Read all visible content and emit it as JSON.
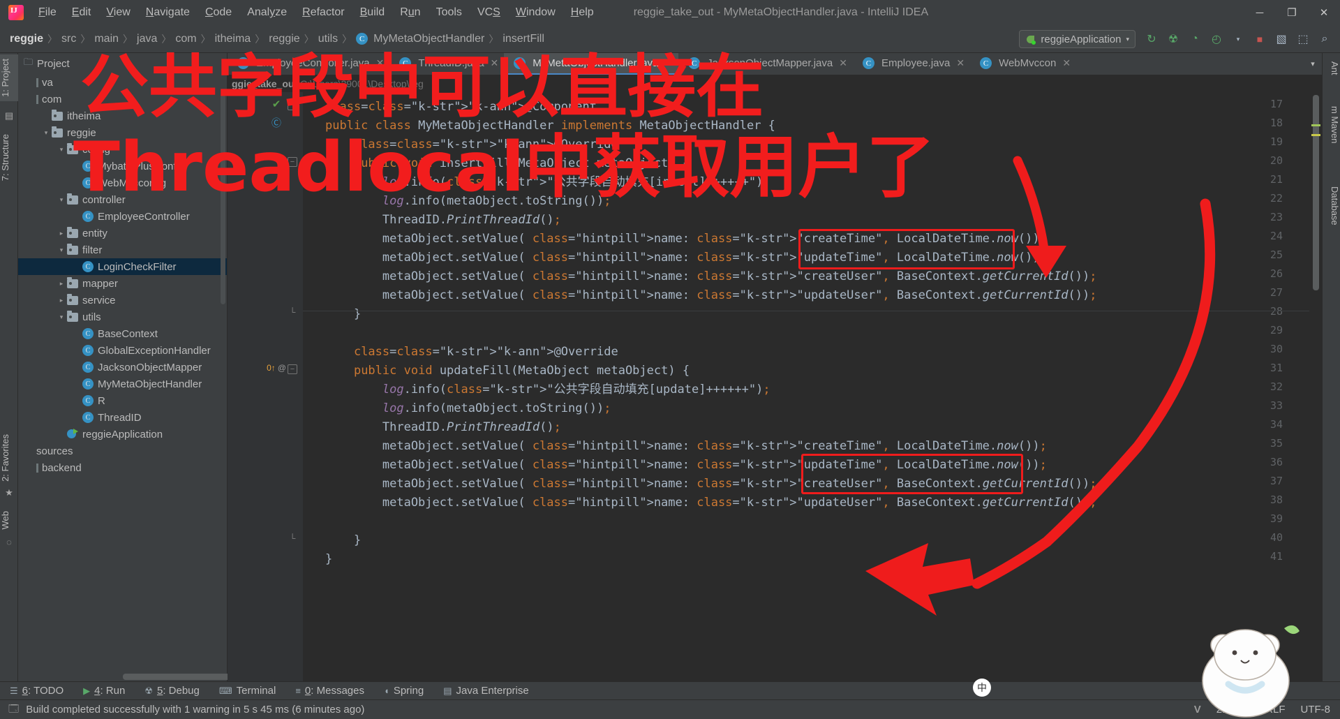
{
  "window": {
    "title": "reggie_take_out - MyMetaObjectHandler.java - IntelliJ IDEA",
    "logo_label": "IJ",
    "minimize": "─",
    "maximize": "❐",
    "close": "✕"
  },
  "menu": [
    {
      "label": "File",
      "mnemonic": "F"
    },
    {
      "label": "Edit",
      "mnemonic": "E"
    },
    {
      "label": "View",
      "mnemonic": "V"
    },
    {
      "label": "Navigate",
      "mnemonic": "N"
    },
    {
      "label": "Code",
      "mnemonic": "C"
    },
    {
      "label": "Analyze",
      "mnemonic": "y"
    },
    {
      "label": "Refactor",
      "mnemonic": "R"
    },
    {
      "label": "Build",
      "mnemonic": "B"
    },
    {
      "label": "Run",
      "mnemonic": "u"
    },
    {
      "label": "Tools",
      "mnemonic": ""
    },
    {
      "label": "VCS",
      "mnemonic": "S"
    },
    {
      "label": "Window",
      "mnemonic": "W"
    },
    {
      "label": "Help",
      "mnemonic": "H"
    }
  ],
  "breadcrumb": {
    "segments": [
      "reggie",
      "src",
      "main",
      "java",
      "com",
      "itheima",
      "reggie",
      "utils"
    ],
    "class_badge": "C",
    "class_name": "MyMetaObjectHandler",
    "member": "insertFill",
    "separator": "〉"
  },
  "toolbar": {
    "run_config": "reggieApplication",
    "run_config_caret": "▾",
    "icons": [
      {
        "name": "run-icon",
        "glyph": "▶"
      },
      {
        "name": "debug-icon",
        "glyph": "☢"
      },
      {
        "name": "run-with-coverage-icon",
        "glyph": "⥁"
      },
      {
        "name": "profiler-icon",
        "glyph": "◴"
      },
      {
        "name": "stop-icon",
        "glyph": "■"
      },
      {
        "name": "update-app-icon",
        "glyph": "↻"
      },
      {
        "name": "open-browser-icon",
        "glyph": "❐"
      },
      {
        "name": "search-everywhere-icon",
        "glyph": "⌕"
      }
    ]
  },
  "left_stripe": {
    "project": "1: Project",
    "structure": "7: Structure",
    "favorites": "2: Favorites",
    "web": "Web"
  },
  "right_stripe": {
    "ant": "Ant",
    "maven": "m Maven",
    "database": "Database"
  },
  "project_panel": {
    "title": "Project",
    "tree": [
      {
        "indent": 0,
        "twist": "",
        "icon": "bar",
        "label": "va"
      },
      {
        "indent": 0,
        "twist": "",
        "icon": "bar",
        "label": "com"
      },
      {
        "indent": 1,
        "twist": "",
        "icon": "folder",
        "label": "itheima"
      },
      {
        "indent": 1,
        "twist": "▾",
        "icon": "folder",
        "label": "reggie"
      },
      {
        "indent": 2,
        "twist": "▾",
        "icon": "folder",
        "label": "config"
      },
      {
        "indent": 3,
        "twist": "",
        "icon": "class",
        "label": "MybatisPlusConfig"
      },
      {
        "indent": 3,
        "twist": "",
        "icon": "class",
        "label": "WebMvcconfig"
      },
      {
        "indent": 2,
        "twist": "▾",
        "icon": "folder",
        "label": "controller"
      },
      {
        "indent": 3,
        "twist": "",
        "icon": "class",
        "label": "EmployeeController"
      },
      {
        "indent": 2,
        "twist": "▸",
        "icon": "folder",
        "label": "entity"
      },
      {
        "indent": 2,
        "twist": "▾",
        "icon": "folder",
        "label": "filter"
      },
      {
        "indent": 3,
        "twist": "",
        "icon": "class",
        "label": "LoginCheckFilter",
        "selected": true
      },
      {
        "indent": 2,
        "twist": "▸",
        "icon": "folder",
        "label": "mapper"
      },
      {
        "indent": 2,
        "twist": "▸",
        "icon": "folder",
        "label": "service"
      },
      {
        "indent": 2,
        "twist": "▾",
        "icon": "folder",
        "label": "utils"
      },
      {
        "indent": 3,
        "twist": "",
        "icon": "class",
        "label": "BaseContext"
      },
      {
        "indent": 3,
        "twist": "",
        "icon": "class",
        "label": "GlobalExceptionHandler"
      },
      {
        "indent": 3,
        "twist": "",
        "icon": "class",
        "label": "JacksonObjectMapper"
      },
      {
        "indent": 3,
        "twist": "",
        "icon": "class",
        "label": "MyMetaObjectHandler"
      },
      {
        "indent": 3,
        "twist": "",
        "icon": "class",
        "label": "R"
      },
      {
        "indent": 3,
        "twist": "",
        "icon": "class",
        "label": "ThreadID"
      },
      {
        "indent": 2,
        "twist": "",
        "icon": "springapp",
        "label": "reggieApplication"
      },
      {
        "indent": 0,
        "twist": "",
        "icon": "none",
        "label": "sources"
      },
      {
        "indent": 0,
        "twist": "",
        "icon": "bar",
        "label": "backend"
      }
    ]
  },
  "editor": {
    "tabs": [
      {
        "label": "EmployeeController.java",
        "icon": "C",
        "active": false
      },
      {
        "label": "ThreadID.java",
        "icon": "C",
        "active": false
      },
      {
        "label": "MyMetaObjectHandler.java",
        "icon": "C",
        "active": true
      },
      {
        "label": "JacksonObjectMapper.java",
        "icon": "C",
        "active": false
      },
      {
        "label": "Employee.java",
        "icon": "C",
        "active": false
      },
      {
        "label": "WebMvccon",
        "icon": "C",
        "active": false
      }
    ],
    "tabs_overflow_caret": "▾",
    "file_path_prefix": "ggie_take_out",
    "file_path": "C:\\Users\\29001\\Desktop\\reg",
    "lines": [
      {
        "n": 17,
        "text": "@Component",
        "fold": "box",
        "gmark": "check-green"
      },
      {
        "n": 18,
        "text": "public class MyMetaObjectHandler implements MetaObjectHandler {",
        "gmark": "class-impl"
      },
      {
        "n": 19,
        "text": "    @Override"
      },
      {
        "n": 20,
        "text": "    public void insertFill(MetaObject metaObject) {",
        "fold": "box"
      },
      {
        "n": 21,
        "text": "        log.info(\"公共字段自动填充[insert]++++++\");"
      },
      {
        "n": 22,
        "text": "        log.info(metaObject.toString());"
      },
      {
        "n": 23,
        "text": "        ThreadID.PrintThreadId();"
      },
      {
        "n": 24,
        "text": "        metaObject.setValue( name: \"createTime\", LocalDateTime.now());"
      },
      {
        "n": 25,
        "text": "        metaObject.setValue( name: \"updateTime\", LocalDateTime.now());"
      },
      {
        "n": 26,
        "text": "        metaObject.setValue( name: \"createUser\", BaseContext.getCurrentId());"
      },
      {
        "n": 27,
        "text": "        metaObject.setValue( name: \"updateUser\", BaseContext.getCurrentId());"
      },
      {
        "n": 28,
        "text": "    }",
        "fold": "end"
      },
      {
        "n": 29,
        "text": ""
      },
      {
        "n": 30,
        "text": "    @Override"
      },
      {
        "n": 31,
        "text": "    public void updateFill(MetaObject metaObject) {",
        "fold": "box",
        "gmark": "override-at"
      },
      {
        "n": 32,
        "text": "        log.info(\"公共字段自动填充[update]++++++\");"
      },
      {
        "n": 33,
        "text": "        log.info(metaObject.toString());"
      },
      {
        "n": 34,
        "text": "        ThreadID.PrintThreadId();"
      },
      {
        "n": 35,
        "text": "        metaObject.setValue( name: \"createTime\", LocalDateTime.now());"
      },
      {
        "n": 36,
        "text": "        metaObject.setValue( name: \"updateTime\", LocalDateTime.now());"
      },
      {
        "n": 37,
        "text": "        metaObject.setValue( name: \"createUser\", BaseContext.getCurrentId());"
      },
      {
        "n": 38,
        "text": "        metaObject.setValue( name: \"updateUser\", BaseContext.getCurrentId());"
      },
      {
        "n": 39,
        "text": ""
      },
      {
        "n": 40,
        "text": "    }",
        "fold": "end"
      },
      {
        "n": 41,
        "text": "}"
      }
    ]
  },
  "annotations": {
    "line1": "公共字段中可以直接在",
    "line2": "Threadlocal中获取用户了",
    "color": "#f21d1d"
  },
  "bottom_bar": [
    {
      "label": "6: TODO",
      "mnemonic": "6",
      "icon": "list-icon"
    },
    {
      "label": "4: Run",
      "mnemonic": "4",
      "icon": "run-icon"
    },
    {
      "label": "5: Debug",
      "mnemonic": "5",
      "icon": "debug-icon"
    },
    {
      "label": "Terminal",
      "mnemonic": "",
      "icon": "terminal-icon"
    },
    {
      "label": "0: Messages",
      "mnemonic": "0",
      "icon": "messages-icon"
    },
    {
      "label": "Spring",
      "mnemonic": "",
      "icon": "spring-icon"
    },
    {
      "label": "Java Enterprise",
      "mnemonic": "",
      "icon": "java-enterprise-icon"
    }
  ],
  "status_bar": {
    "message": "Build completed successfully with 1 warning in 5 s 45 ms (6 minutes ago)",
    "vim_indicator": "V",
    "time": "21:44",
    "line_separator": "CRLF",
    "encoding": "UTF-8",
    "ime_badge": "中"
  }
}
